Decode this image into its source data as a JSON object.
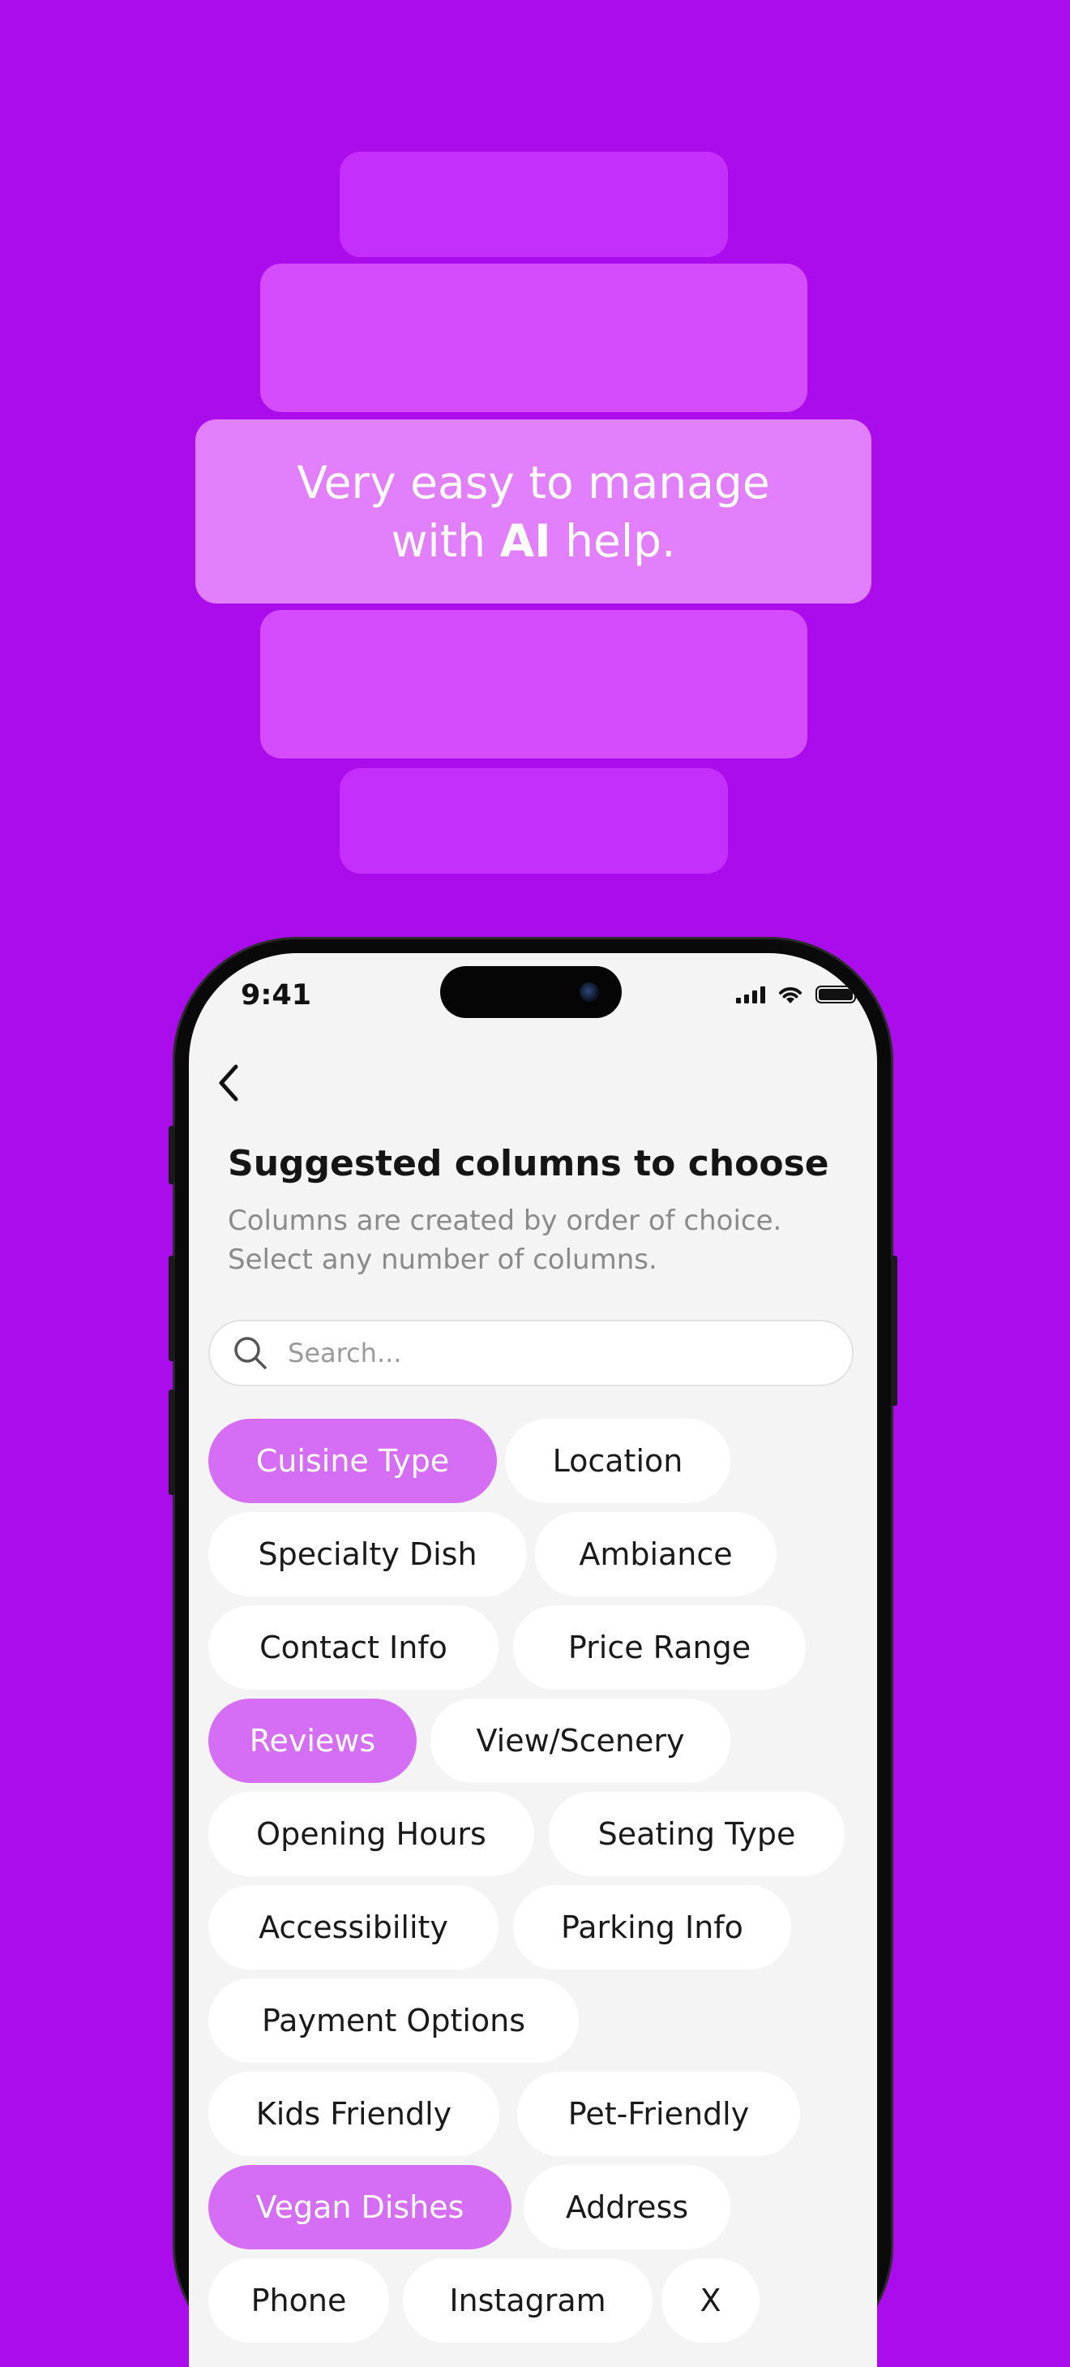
{
  "hero": {
    "line1": "Very easy to manage",
    "line2_prefix": "with ",
    "line2_bold": "AI",
    "line2_suffix": " help."
  },
  "status_bar": {
    "time": "9:41"
  },
  "screen": {
    "title": "Suggested columns to choose",
    "subtitle_line1": "Columns are created by order of choice.",
    "subtitle_line2": "Select any number of columns.",
    "search": {
      "placeholder": "Search...",
      "value": ""
    }
  },
  "chip_rows": [
    [
      {
        "label": "Cuisine Type",
        "selected": true
      },
      {
        "label": "Location",
        "selected": false
      }
    ],
    [
      {
        "label": "Specialty Dish",
        "selected": false
      },
      {
        "label": "Ambiance",
        "selected": false
      }
    ],
    [
      {
        "label": "Contact Info",
        "selected": false
      },
      {
        "label": "Price Range",
        "selected": false
      }
    ],
    [
      {
        "label": "Reviews",
        "selected": true
      },
      {
        "label": "View/Scenery",
        "selected": false
      }
    ],
    [
      {
        "label": "Opening Hours",
        "selected": false
      },
      {
        "label": "Seating Type",
        "selected": false
      }
    ],
    [
      {
        "label": "Accessibility",
        "selected": false
      },
      {
        "label": "Parking Info",
        "selected": false
      }
    ],
    [
      {
        "label": "Payment Options",
        "selected": false
      }
    ],
    [
      {
        "label": "Kids Friendly",
        "selected": false
      },
      {
        "label": "Pet-Friendly",
        "selected": false
      }
    ],
    [
      {
        "label": "Vegan Dishes",
        "selected": true
      },
      {
        "label": "Address",
        "selected": false
      }
    ],
    [
      {
        "label": "Phone",
        "selected": false
      },
      {
        "label": "Instagram",
        "selected": false
      },
      {
        "label": "X",
        "selected": false
      }
    ]
  ],
  "colors": {
    "background": "#ab0cec",
    "chip_selected": "#d56ef4",
    "chip_default": "#ffffff",
    "screen_bg": "#f4f4f4"
  },
  "icons": {
    "back": "chevron-left-icon",
    "search": "search-icon",
    "signal": "cellular-signal-icon",
    "wifi": "wifi-icon",
    "battery": "battery-icon"
  }
}
